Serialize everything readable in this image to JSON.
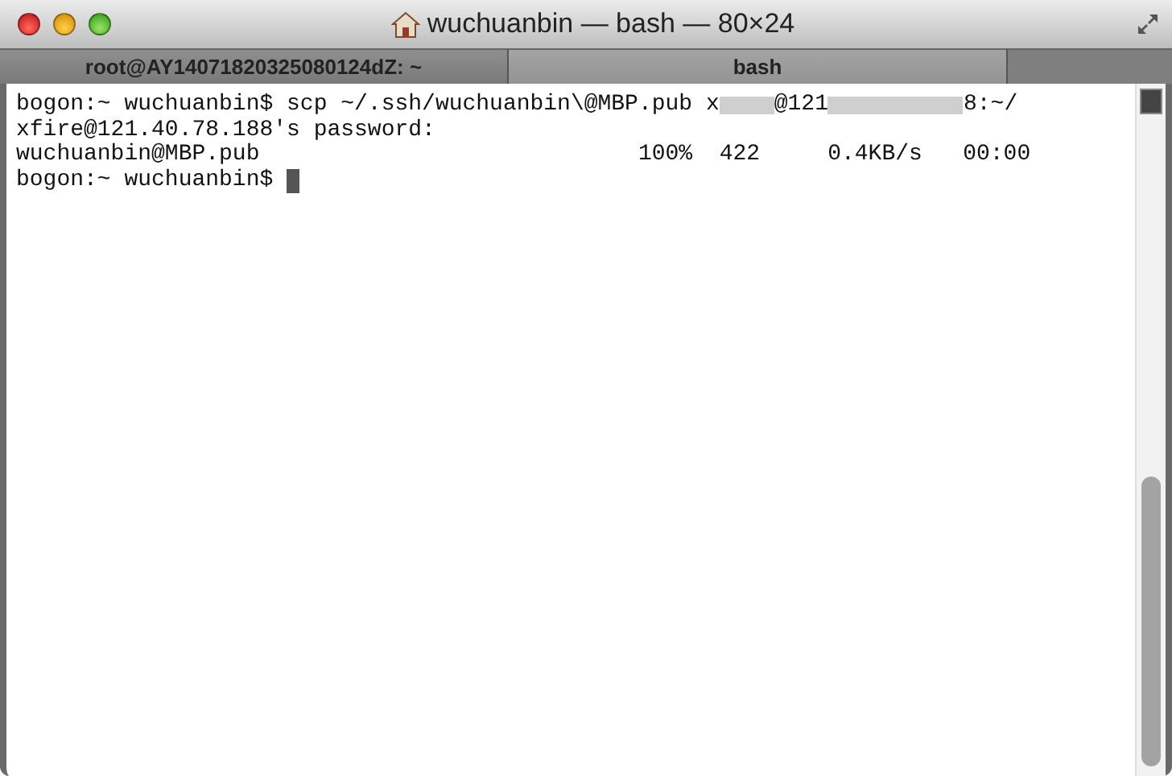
{
  "window": {
    "title": "wuchuanbin — bash — 80×24"
  },
  "tabs": [
    {
      "label": "root@AY14071820325080124dZ: ~",
      "selected": false
    },
    {
      "label": "bash",
      "selected": true
    }
  ],
  "terminal": {
    "lines": [
      [
        {
          "kind": "text",
          "text": "bogon:~ wuchuanbin$ scp ~/.ssh/wuchuanbin\\@MBP.pub x"
        },
        {
          "kind": "mask"
        },
        {
          "kind": "text",
          "text": "@121"
        },
        {
          "kind": "mask"
        },
        {
          "kind": "text",
          "text": "8:~/"
        }
      ],
      [
        {
          "kind": "text",
          "text": "xfire@121.40.78.188's password:"
        }
      ],
      [
        {
          "kind": "text",
          "text": "wuchuanbin@MBP.pub                            100%  422     0.4KB/s   00:00"
        }
      ],
      [
        {
          "kind": "text",
          "text": "bogon:~ wuchuanbin$ "
        },
        {
          "kind": "cursor"
        }
      ]
    ]
  }
}
